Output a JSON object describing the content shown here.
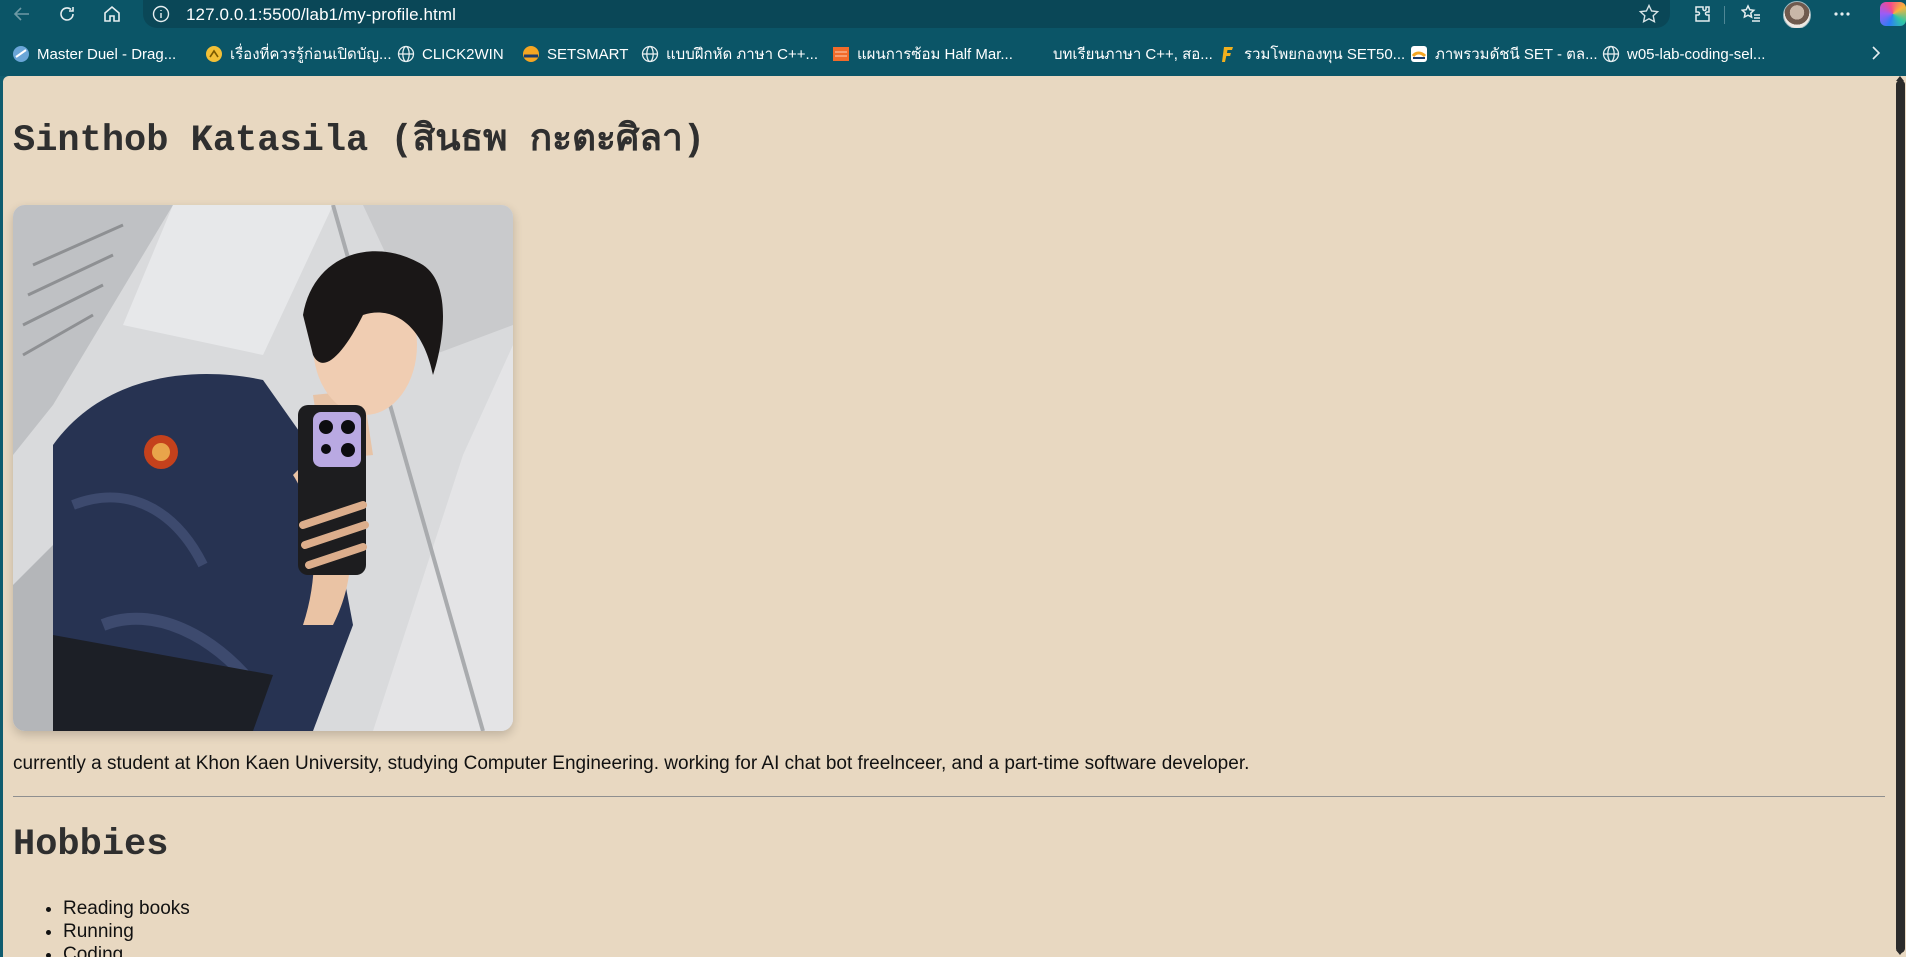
{
  "browser": {
    "url": "127.0.0.1:5500/lab1/my-profile.html",
    "bookmarks": [
      {
        "label": "Master Duel - Drag...",
        "icon": "master-duel-icon"
      },
      {
        "label": "เรื่องที่ควรรู้ก่อนเปิดบัญ...",
        "icon": "bank-icon"
      },
      {
        "label": "CLICK2WIN",
        "icon": "globe-icon"
      },
      {
        "label": "SETSMART",
        "icon": "setsmart-icon"
      },
      {
        "label": "แบบฝึกหัด ภาษา C++...",
        "icon": "globe-icon"
      },
      {
        "label": "แผนการซ้อม Half Mar...",
        "icon": "orange-site-icon"
      },
      {
        "label": "บทเรียนภาษา C++, สอ...",
        "icon": "blank-icon"
      },
      {
        "label": "รวมโพยกองทุน SET50...",
        "icon": "f-letter-icon"
      },
      {
        "label": "ภาพรวมดัชนี SET - ตล...",
        "icon": "set-index-icon"
      },
      {
        "label": "w05-lab-coding-sel...",
        "icon": "globe-icon"
      }
    ]
  },
  "page": {
    "name_heading": "Sinthob Katasila (สินธพ กะตะศิลา)",
    "bio": "currently a student at Khon Kaen University, studying Computer Engineering. working for AI chat bot freelnceer, and a part-time software developer.",
    "hobbies_heading": "Hobbies",
    "hobbies": [
      "Reading books",
      "Running",
      "Coding"
    ]
  },
  "colors": {
    "page_background": "#e8d8c1",
    "chrome": "#0b5567",
    "address_bar": "#0a4757",
    "heading_text": "#2f2f2f"
  }
}
